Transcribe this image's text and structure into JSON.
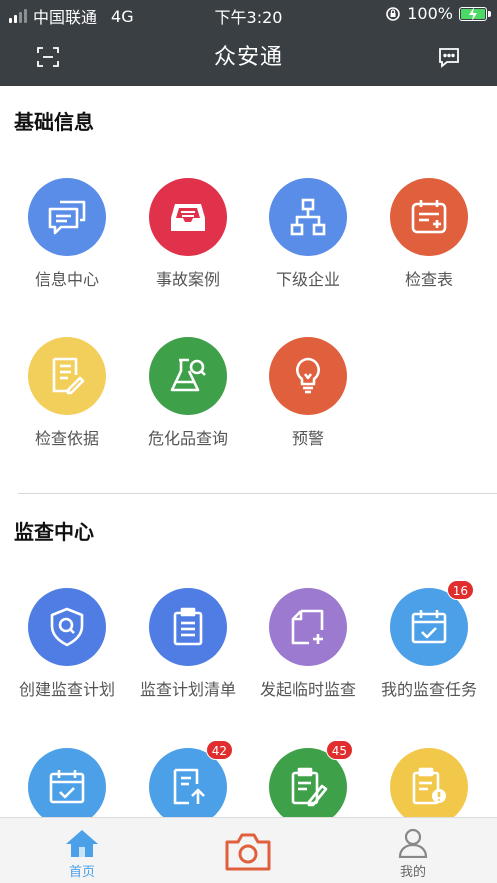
{
  "status_bar": {
    "carrier": "中国联通",
    "network": "4G",
    "time": "下午3:20",
    "battery": "100%",
    "battery_level": 1.0
  },
  "header": {
    "title": "众安通",
    "left_icon": "scan-icon",
    "right_icon": "message-icon"
  },
  "sections": {
    "basic": {
      "title": "基础信息",
      "items": [
        {
          "label": "信息中心",
          "icon": "chat-icon",
          "color": "#5a8de8"
        },
        {
          "label": "事故案例",
          "icon": "inbox-icon",
          "color": "#e0324a"
        },
        {
          "label": "下级企业",
          "icon": "org-chart-icon",
          "color": "#5a8de8"
        },
        {
          "label": "检查表",
          "icon": "form-icon",
          "color": "#e0603e"
        },
        {
          "label": "检查依据",
          "icon": "document-icon",
          "color": "#f2cf5b"
        },
        {
          "label": "危化品查询",
          "icon": "flask-search-icon",
          "color": "#3fa04a"
        },
        {
          "label": "预警",
          "icon": "lightbulb-icon",
          "color": "#e0603e"
        }
      ]
    },
    "supervision": {
      "title": "监查中心",
      "items": [
        {
          "label": "创建监查计划",
          "icon": "shield-search-icon",
          "color": "#4f7de4"
        },
        {
          "label": "监查计划清单",
          "icon": "clipboard-list-icon",
          "color": "#4f7de4"
        },
        {
          "label": "发起临时监查",
          "icon": "note-add-icon",
          "color": "#9c7ad0"
        },
        {
          "label": "我的监查任务",
          "icon": "calendar-check-icon",
          "color": "#4ba0e8",
          "badge": "16"
        },
        {
          "label": "",
          "icon": "calendar-check-icon",
          "color": "#4ba0e8"
        },
        {
          "label": "",
          "icon": "document-upload-icon",
          "color": "#4ba0e8",
          "badge": "42"
        },
        {
          "label": "",
          "icon": "clipboard-edit-icon",
          "color": "#3fa04a",
          "badge": "45"
        },
        {
          "label": "",
          "icon": "clipboard-alert-icon",
          "color": "#f2c84a"
        }
      ]
    }
  },
  "tab_bar": {
    "home": {
      "label": "首页",
      "icon": "home-icon",
      "color": "#4ba0e8"
    },
    "camera": {
      "icon": "camera-icon",
      "color": "#e0603e"
    },
    "mine": {
      "label": "我的",
      "icon": "user-icon",
      "color": "#888888"
    }
  }
}
